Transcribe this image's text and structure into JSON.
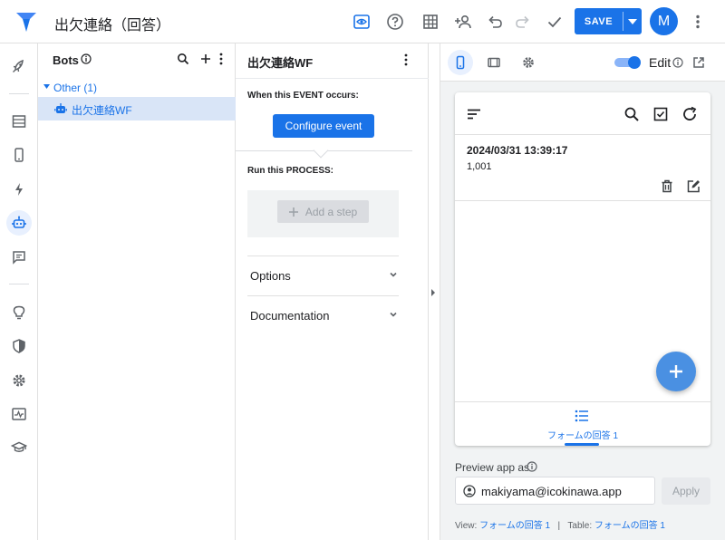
{
  "app": {
    "title": "出欠連絡（回答）"
  },
  "toolbar": {
    "save_label": "SAVE",
    "avatar_letter": "M"
  },
  "bots_panel": {
    "title": "Bots",
    "group_label": "Other (1)",
    "items": [
      {
        "label": "出欠連絡WF"
      }
    ]
  },
  "bot_editor": {
    "title": "出欠連絡WF",
    "event_heading": "When this EVENT occurs:",
    "configure_label": "Configure event",
    "process_heading": "Run this PROCESS:",
    "add_step_label": "Add a step",
    "sections": [
      {
        "label": "Options"
      },
      {
        "label": "Documentation"
      }
    ]
  },
  "preview": {
    "edit_label": "Edit",
    "edit_toggle_on": true,
    "record": {
      "timestamp": "2024/03/31 13:39:17",
      "value": "1,001"
    },
    "footer_tab": "フォームの回答 1",
    "preview_as_label": "Preview app as",
    "email_value": "makiyama@icokinawa.app",
    "apply_label": "Apply",
    "view_prefix": "View:",
    "view_name": "フォームの回答 1",
    "table_divider": "|",
    "table_prefix": "Table:",
    "table_name": "フォームの回答 1"
  },
  "colors": {
    "accent": "#1a73e8",
    "selected_row": "#d9e5f7",
    "fab": "#4a90e2"
  },
  "icons": {
    "toolbar": [
      "preview-eye-icon",
      "help-icon",
      "table-grid-icon",
      "share-user-icon",
      "undo-icon",
      "redo-icon",
      "check-icon",
      "chevron-down-icon",
      "more-vert-icon"
    ],
    "rail": [
      "rocket-icon",
      "data-table-icon",
      "phone-icon",
      "bolt-icon",
      "bot-icon",
      "chat-icon",
      "lightbulb-icon",
      "shield-icon",
      "gear-icon",
      "activity-icon",
      "graduation-cap-icon"
    ]
  }
}
